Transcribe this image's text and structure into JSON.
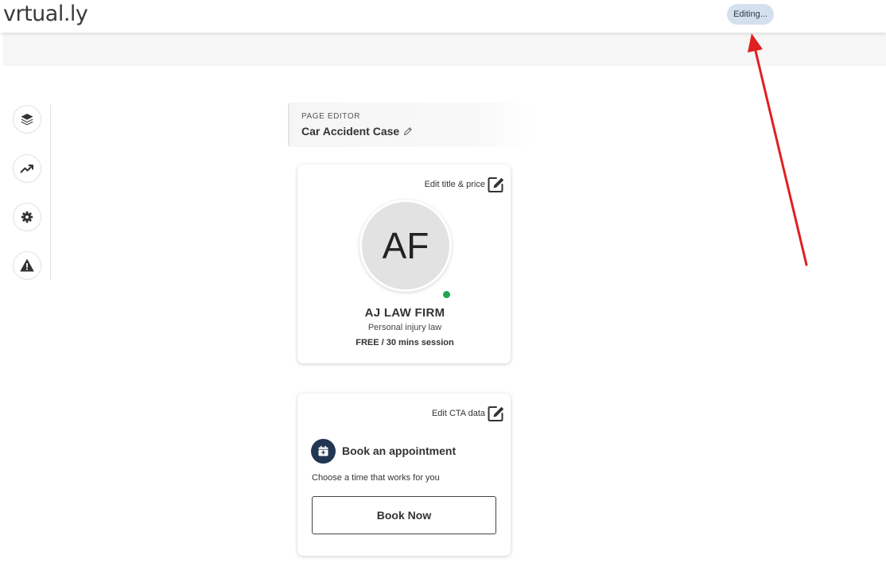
{
  "app": {
    "logo": "vrtual.ly",
    "status": "Editing..."
  },
  "sidebar": {
    "items": [
      {
        "name": "layers",
        "icon": "layers-icon"
      },
      {
        "name": "analytics",
        "icon": "trending-up-icon"
      },
      {
        "name": "settings",
        "icon": "gear-icon"
      },
      {
        "name": "alerts",
        "icon": "warning-icon"
      }
    ]
  },
  "editor": {
    "label": "PAGE EDITOR",
    "title": "Car Accident Case"
  },
  "profile_card": {
    "edit_label": "Edit title & price",
    "initials": "AF",
    "name": "AJ LAW FIRM",
    "subtitle": "Personal injury law",
    "price": "FREE / 30 mins session"
  },
  "cta_card": {
    "edit_label": "Edit CTA data",
    "title": "Book an appointment",
    "description": "Choose a time that works for you",
    "button_label": "Book Now"
  },
  "colors": {
    "accent": "#223552",
    "status_pill": "#d5e0ef",
    "online": "#22a550",
    "annotation": "#e02020"
  }
}
